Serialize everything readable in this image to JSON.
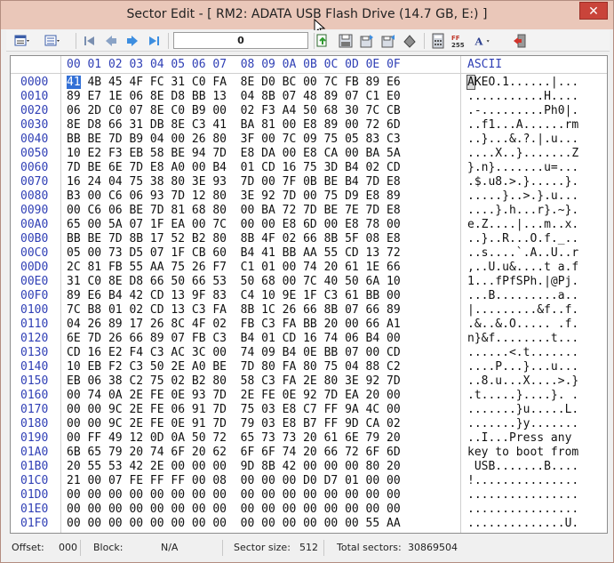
{
  "window": {
    "title": "Sector Edit - [ RM2: ADATA USB Flash Drive (14.7 GB, E:) ]",
    "close_label": "✕"
  },
  "toolbar": {
    "sector_value": "0",
    "icons": [
      "view-mode-icon",
      "view-options-icon",
      "first-sector-icon",
      "previous-sector-icon",
      "next-sector-icon",
      "last-sector-icon",
      "copy-icon",
      "save-icon",
      "export-icon",
      "import-icon",
      "fill-icon",
      "calculator-icon",
      "hex-convert-icon",
      "font-icon",
      "exit-icon"
    ]
  },
  "grid": {
    "offset_header": "",
    "column_headers": [
      "00",
      "01",
      "02",
      "03",
      "04",
      "05",
      "06",
      "07",
      "08",
      "09",
      "0A",
      "0B",
      "0C",
      "0D",
      "0E",
      "0F"
    ],
    "ascii_header": "ASCII",
    "rows": [
      {
        "offset": "0000",
        "hex": "41 4B 45 4F FC 31 C0 FA  8E D0 BC 00 7C FB 89 E6",
        "ascii": "AKEO.1......|..."
      },
      {
        "offset": "0010",
        "hex": "89 E7 1E 06 8E D8 BB 13  04 8B 07 48 89 07 C1 E0",
        "ascii": "...........H...."
      },
      {
        "offset": "0020",
        "hex": "06 2D C0 07 8E C0 B9 00  02 F3 A4 50 68 30 7C CB",
        "ascii": ".-.........Ph0|."
      },
      {
        "offset": "0030",
        "hex": "8E D8 66 31 DB 8E C3 41  BA 81 00 E8 89 00 72 6D",
        "ascii": "..f1...A......rm"
      },
      {
        "offset": "0040",
        "hex": "BB BE 7D B9 04 00 26 80  3F 00 7C 09 75 05 83 C3",
        "ascii": "..}...&.?.|.u..."
      },
      {
        "offset": "0050",
        "hex": "10 E2 F3 EB 58 BE 94 7D  E8 DA 00 E8 CA 00 BA 5A",
        "ascii": "....X..}.......Z"
      },
      {
        "offset": "0060",
        "hex": "7D BE 6E 7D E8 A0 00 B4  01 CD 16 75 3D B4 02 CD",
        "ascii": "}.n}.......u=..."
      },
      {
        "offset": "0070",
        "hex": "16 24 04 75 38 80 3E 93  7D 00 7F 0B BE B4 7D E8",
        "ascii": ".$.u8.>.}.....}."
      },
      {
        "offset": "0080",
        "hex": "B3 00 C6 06 93 7D 12 80  3E 92 7D 00 75 D9 E8 89",
        "ascii": ".....}..>.}.u..."
      },
      {
        "offset": "0090",
        "hex": "00 C6 06 BE 7D 81 68 80  00 BA 72 7D BE 7E 7D E8",
        "ascii": "....}.h...r}.~}."
      },
      {
        "offset": "00A0",
        "hex": "65 00 5A 07 1F EA 00 7C  00 00 E8 6D 00 E8 78 00",
        "ascii": "e.Z....|...m..x."
      },
      {
        "offset": "00B0",
        "hex": "BB BE 7D 8B 17 52 B2 80  8B 4F 02 66 8B 5F 08 E8",
        "ascii": "..}..R...O.f._.."
      },
      {
        "offset": "00C0",
        "hex": "05 00 73 D5 07 1F CB 60  B4 41 BB AA 55 CD 13 72",
        "ascii": "..s....`.A..U..r"
      },
      {
        "offset": "00D0",
        "hex": "2C 81 FB 55 AA 75 26 F7  C1 01 00 74 20 61 1E 66",
        "ascii": ",..U.u&....t a.f"
      },
      {
        "offset": "00E0",
        "hex": "31 C0 8E D8 66 50 66 53  50 68 00 7C 40 50 6A 10",
        "ascii": "1...fPfSPh.|@Pj."
      },
      {
        "offset": "00F0",
        "hex": "89 E6 B4 42 CD 13 9F 83  C4 10 9E 1F C3 61 BB 00",
        "ascii": "...B.........a.."
      },
      {
        "offset": "0100",
        "hex": "7C B8 01 02 CD 13 C3 FA  8B 1C 26 66 8B 07 66 89",
        "ascii": "|.........&f..f."
      },
      {
        "offset": "0110",
        "hex": "04 26 89 17 26 8C 4F 02  FB C3 FA BB 20 00 66 A1",
        "ascii": ".&..&.O..... .f."
      },
      {
        "offset": "0120",
        "hex": "6E 7D 26 66 89 07 FB C3  B4 01 CD 16 74 06 B4 00",
        "ascii": "n}&f........t..."
      },
      {
        "offset": "0130",
        "hex": "CD 16 E2 F4 C3 AC 3C 00  74 09 B4 0E BB 07 00 CD",
        "ascii": "......<.t......."
      },
      {
        "offset": "0140",
        "hex": "10 EB F2 C3 50 2E A0 BE  7D 80 FA 80 75 04 88 C2",
        "ascii": "....P...}...u..."
      },
      {
        "offset": "0150",
        "hex": "EB 06 38 C2 75 02 B2 80  58 C3 FA 2E 80 3E 92 7D",
        "ascii": "..8.u...X....>.}"
      },
      {
        "offset": "0160",
        "hex": "00 74 0A 2E FE 0E 93 7D  2E FE 0E 92 7D EA 20 00",
        "ascii": ".t.....}....}. ."
      },
      {
        "offset": "0170",
        "hex": "00 00 9C 2E FE 06 91 7D  75 03 E8 C7 FF 9A 4C 00",
        "ascii": ".......}u.....L."
      },
      {
        "offset": "0180",
        "hex": "00 00 9C 2E FE 0E 91 7D  79 03 E8 B7 FF 9D CA 02",
        "ascii": ".......}y......."
      },
      {
        "offset": "0190",
        "hex": "00 FF 49 12 0D 0A 50 72  65 73 73 20 61 6E 79 20",
        "ascii": "..I...Press any "
      },
      {
        "offset": "01A0",
        "hex": "6B 65 79 20 74 6F 20 62  6F 6F 74 20 66 72 6F 6D",
        "ascii": "key to boot from"
      },
      {
        "offset": "01B0",
        "hex": "20 55 53 42 2E 00 00 00  9D 8B 42 00 00 00 80 20",
        "ascii": " USB.......B.... "
      },
      {
        "offset": "01C0",
        "hex": "21 00 07 FE FF FF 00 08  00 00 00 D0 D7 01 00 00",
        "ascii": "!..............."
      },
      {
        "offset": "01D0",
        "hex": "00 00 00 00 00 00 00 00  00 00 00 00 00 00 00 00",
        "ascii": "................"
      },
      {
        "offset": "01E0",
        "hex": "00 00 00 00 00 00 00 00  00 00 00 00 00 00 00 00",
        "ascii": "................"
      },
      {
        "offset": "01F0",
        "hex": "00 00 00 00 00 00 00 00  00 00 00 00 00 00 55 AA",
        "ascii": "..............U."
      }
    ]
  },
  "status": {
    "offset_label": "Offset:",
    "offset_value": "000",
    "block_label": "Block:",
    "block_value": "N/A",
    "sector_size_label": "Sector size:",
    "sector_size_value": "512",
    "total_sectors_label": "Total sectors:",
    "total_sectors_value": "30869504"
  }
}
